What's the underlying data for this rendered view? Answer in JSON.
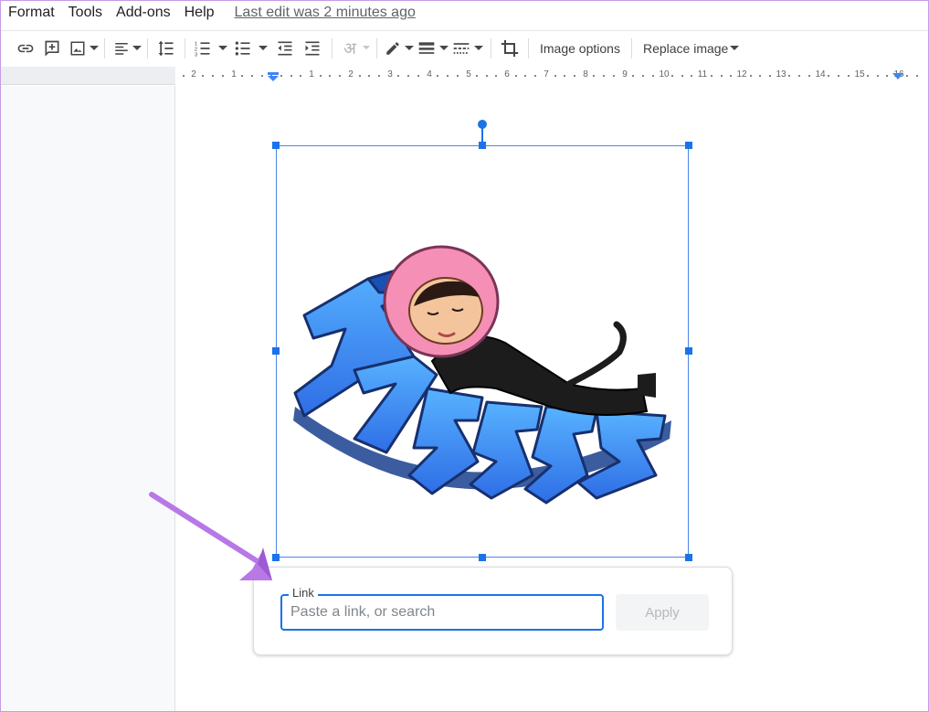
{
  "menu": {
    "items": [
      "Format",
      "Tools",
      "Add-ons",
      "Help"
    ],
    "last_edit": "Last edit was 2 minutes ago"
  },
  "toolbar": {
    "icons": [
      "link-icon",
      "add-comment-icon",
      "insert-image-icon",
      "align-left-icon",
      "line-spacing-icon",
      "numbered-list-icon",
      "bulleted-list-icon",
      "decrease-indent-icon",
      "increase-indent-icon",
      "input-tools-icon",
      "border-color-icon",
      "border-weight-icon",
      "border-dash-icon",
      "crop-icon"
    ],
    "input_tools_glyph": "अ",
    "image_options_label": "Image options",
    "replace_image_label": "Replace image"
  },
  "ruler": {
    "labels": [
      "2",
      "1",
      "1",
      "2",
      "3",
      "4",
      "5",
      "6",
      "7",
      "8",
      "9",
      "10",
      "11",
      "12",
      "13",
      "14",
      "15",
      "16"
    ]
  },
  "link_popup": {
    "label": "Link",
    "placeholder": "Paste a link, or search",
    "value": "",
    "apply_label": "Apply"
  },
  "colors": {
    "accent": "#1a73e8",
    "annotation_arrow": "#b878e6"
  }
}
